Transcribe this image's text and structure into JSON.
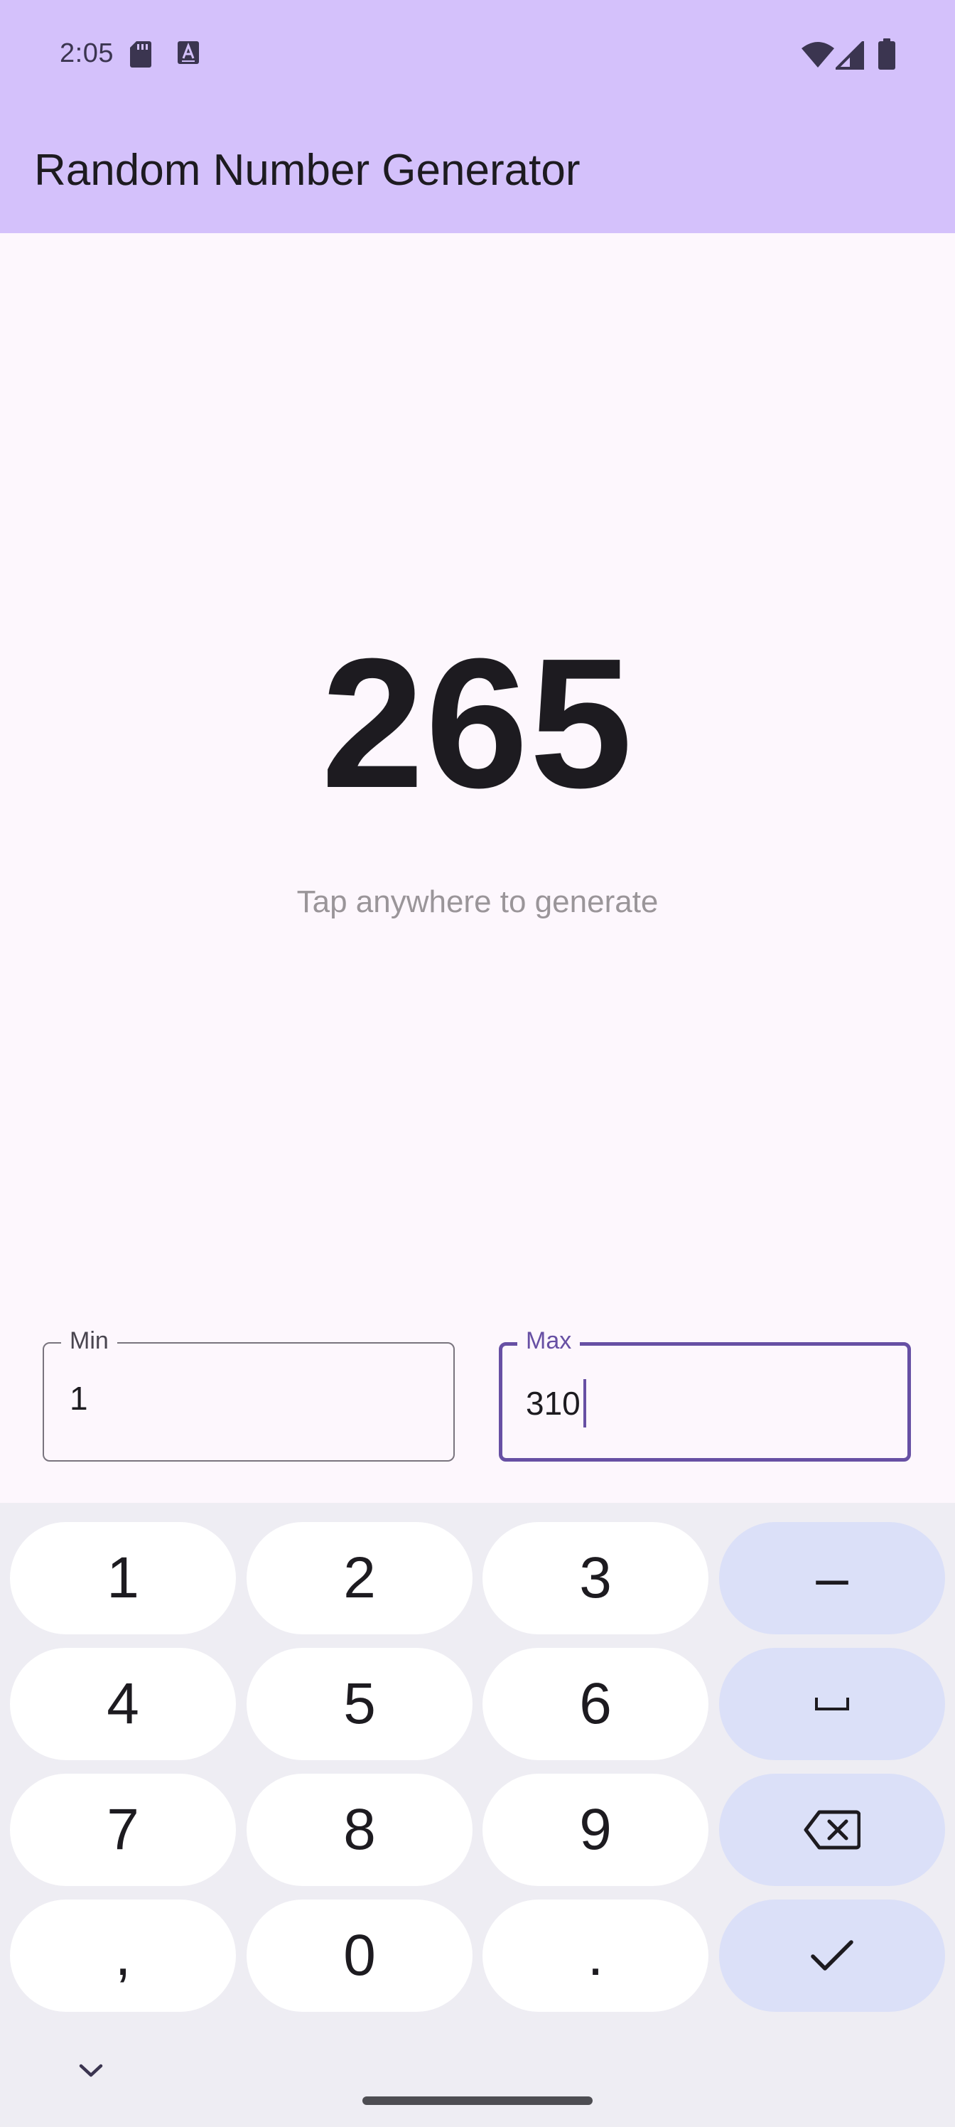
{
  "status_bar": {
    "time": "2:05",
    "icons": [
      "sd-card-icon",
      "keyboard-a-icon",
      "wifi-icon",
      "cell-signal-icon",
      "battery-icon"
    ]
  },
  "app_bar": {
    "title": "Random Number Generator"
  },
  "main": {
    "result": "265",
    "hint": "Tap anywhere to generate"
  },
  "fields": {
    "min": {
      "label": "Min",
      "value": "1"
    },
    "max": {
      "label": "Max",
      "value": "310"
    }
  },
  "keyboard": {
    "keys": [
      {
        "label": "1"
      },
      {
        "label": "2"
      },
      {
        "label": "3"
      },
      {
        "label": "–"
      },
      {
        "label": "4"
      },
      {
        "label": "5"
      },
      {
        "label": "6"
      },
      {
        "icon": "space-icon"
      },
      {
        "label": "7"
      },
      {
        "label": "8"
      },
      {
        "label": "9"
      },
      {
        "icon": "backspace-icon"
      },
      {
        "label": ","
      },
      {
        "label": "0"
      },
      {
        "label": "."
      },
      {
        "icon": "checkmark-icon"
      }
    ],
    "hide_icon": "chevron-down-icon"
  },
  "colors": {
    "app_bar": "#d4c1fb",
    "background": "#fdf7fd",
    "accent": "#6750a4",
    "key": "#ffffff",
    "function_key": "#dbe0f8",
    "keyboard_bg": "#eeedf3"
  }
}
